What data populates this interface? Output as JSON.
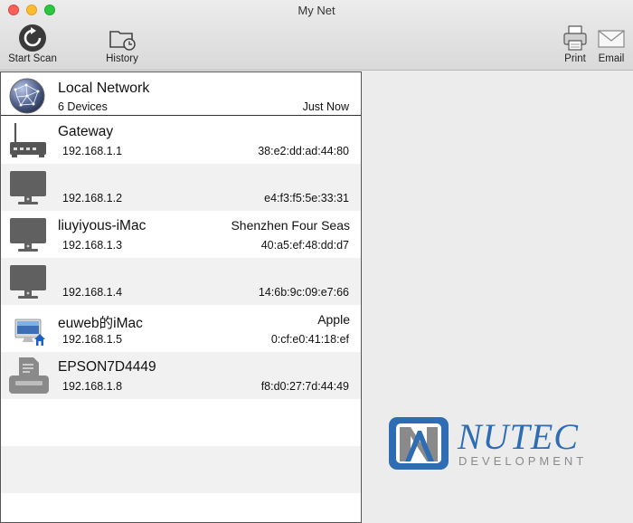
{
  "window": {
    "title": "My Net"
  },
  "toolbar": {
    "start_scan": {
      "label": "Start Scan",
      "icon": "refresh-icon"
    },
    "history": {
      "label": "History",
      "icon": "folder-clock-icon"
    },
    "print": {
      "label": "Print",
      "icon": "printer-icon"
    },
    "email": {
      "label": "Email",
      "icon": "envelope-icon"
    }
  },
  "network": {
    "title": "Local Network",
    "device_count": "6 Devices",
    "last_scan": "Just Now",
    "icon": "globe-network-icon"
  },
  "devices": [
    {
      "name": "Gateway",
      "vendor": "",
      "ip": "192.168.1.1",
      "mac": "38:e2:dd:ad:44:80",
      "icon": "router-icon"
    },
    {
      "name": "",
      "vendor": "",
      "ip": "192.168.1.2",
      "mac": "e4:f3:f5:5e:33:31",
      "icon": "monitor-icon"
    },
    {
      "name": "liuyiyous-iMac",
      "vendor": "Shenzhen Four Seas",
      "ip": "192.168.1.3",
      "mac": "40:a5:ef:48:dd:d7",
      "icon": "monitor-icon"
    },
    {
      "name": "",
      "vendor": "",
      "ip": "192.168.1.4",
      "mac": "14:6b:9c:09:e7:66",
      "icon": "monitor-icon"
    },
    {
      "name": "euweb的iMac",
      "vendor": "Apple",
      "ip": "192.168.1.5",
      "mac": "0:cf:e0:41:18:ef",
      "icon": "imac-home-icon"
    },
    {
      "name": "EPSON7D4449",
      "vendor": "",
      "ip": "192.168.1.8",
      "mac": "f8:d0:27:7d:44:49",
      "icon": "printer-device-icon"
    }
  ],
  "branding": {
    "logo_name": "NUTEC",
    "logo_sub": "DEVELOPMENT",
    "accent": "#2e6db4",
    "grey": "#8a8a8a"
  }
}
